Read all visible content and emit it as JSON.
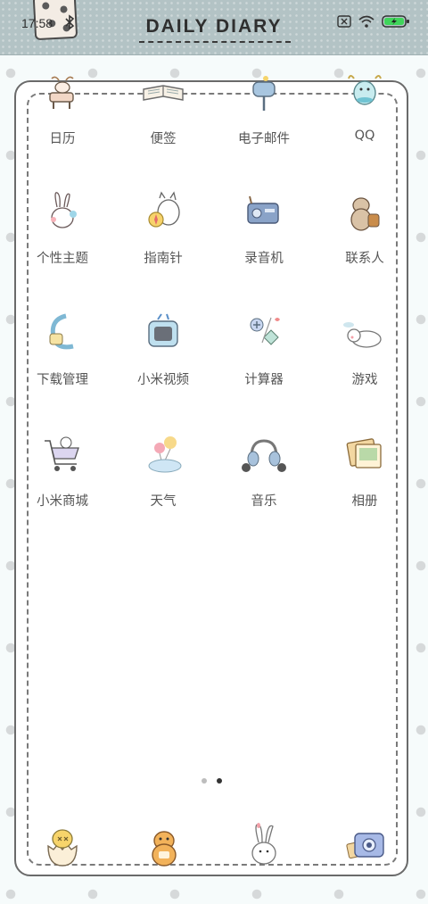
{
  "status_bar": {
    "time": "17:58",
    "icons": [
      "bluetooth-icon",
      "sim-off-icon",
      "wifi-icon",
      "battery-charging-icon"
    ]
  },
  "header": {
    "title": "DAILY DIARY"
  },
  "apps": [
    {
      "label": "日历",
      "icon": "calendar-deer-icon"
    },
    {
      "label": "便签",
      "icon": "notebook-icon"
    },
    {
      "label": "电子邮件",
      "icon": "mailbox-icon"
    },
    {
      "label": "QQ",
      "icon": "qq-penguin-icon"
    },
    {
      "label": "个性主题",
      "icon": "bunny-theme-icon"
    },
    {
      "label": "指南针",
      "icon": "cat-compass-icon"
    },
    {
      "label": "录音机",
      "icon": "radio-recorder-icon"
    },
    {
      "label": "联系人",
      "icon": "hamster-contacts-icon"
    },
    {
      "label": "下载管理",
      "icon": "download-moon-icon"
    },
    {
      "label": "小米视频",
      "icon": "tv-video-icon"
    },
    {
      "label": "计算器",
      "icon": "calculator-icon"
    },
    {
      "label": "游戏",
      "icon": "sleeping-cat-game-icon"
    },
    {
      "label": "小米商城",
      "icon": "shopping-cart-icon"
    },
    {
      "label": "天气",
      "icon": "balloon-cloud-weather-icon"
    },
    {
      "label": "音乐",
      "icon": "headphones-music-icon"
    },
    {
      "label": "相册",
      "icon": "photo-album-icon"
    }
  ],
  "dock": [
    "chick-egg-phone-icon",
    "hamster-messages-icon",
    "bunny-browser-icon",
    "camera-icon"
  ],
  "page_indicator": {
    "pages": 2,
    "current": 2
  },
  "colors": {
    "header_bg": "#b3c3c5",
    "label_text": "#555555",
    "panel_border": "#6a6a6a"
  }
}
